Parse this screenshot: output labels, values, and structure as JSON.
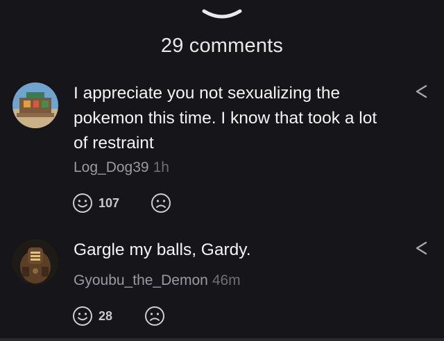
{
  "header": {
    "comment_count": "29 comments"
  },
  "comments": [
    {
      "text": "I appreciate you not sexualizing the pokemon this time. I know that took a lot of restraint",
      "username": "Log_Dog39",
      "time": "1h",
      "likes": "107"
    },
    {
      "text": "Gargle my balls, Gardy.",
      "username": "Gyoubu_the_Demon",
      "time": "46m",
      "likes": "28"
    }
  ],
  "icons": {
    "collapse": "chevron-down-icon",
    "share": "share-icon",
    "upvote": "smile-face-icon",
    "downvote": "sad-face-icon"
  },
  "colors": {
    "background": "#16161a",
    "text": "#f4f4f4",
    "muted": "#9a9aa0"
  }
}
